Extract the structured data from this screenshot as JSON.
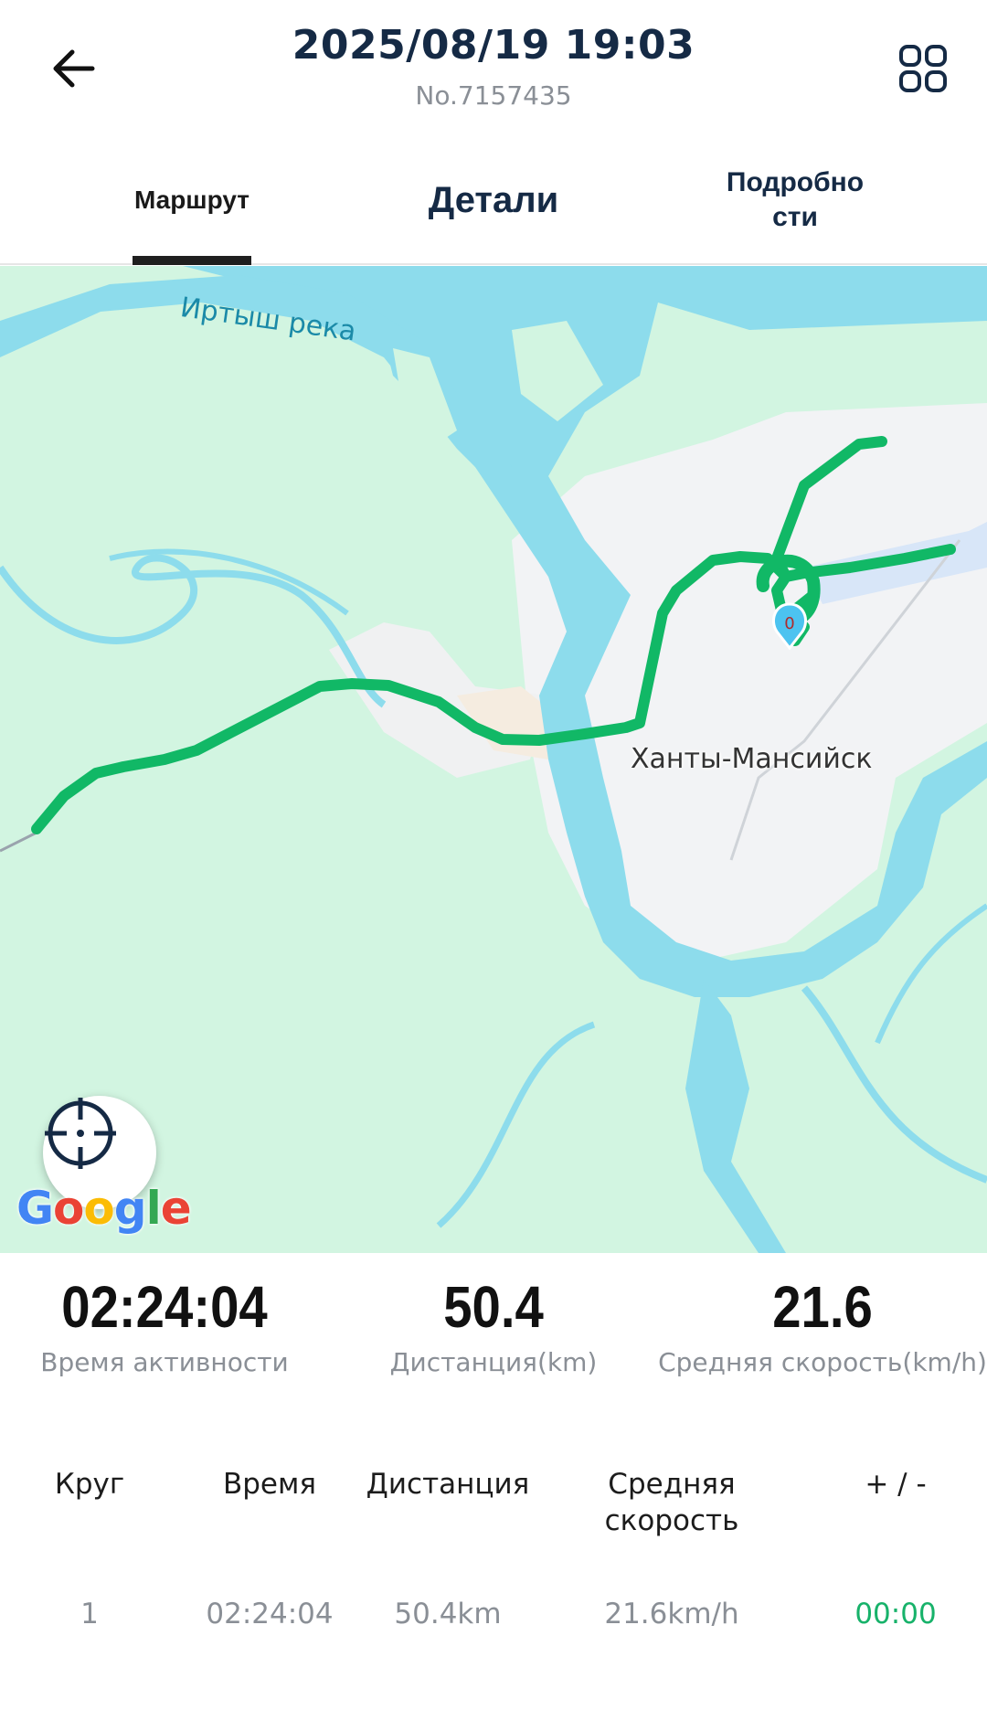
{
  "header": {
    "title": "2025/08/19 19:03",
    "subtitle": "No.7157435",
    "back_icon": "arrow-left-icon",
    "menu_icon": "grid-icon"
  },
  "tabs": [
    {
      "label": "Маршрут",
      "active": true
    },
    {
      "label": "Детали",
      "active": false
    },
    {
      "label": "Подробно\nсти",
      "active": false
    }
  ],
  "map": {
    "river_label": "Иртыш река",
    "city_label": "Ханты-Мансийск",
    "start_marker": "0",
    "attribution": "Google",
    "recenter_icon": "crosshair-icon",
    "colors": {
      "land": "#d2f5e1",
      "water": "#8ddcec",
      "city": "#f2f3f5",
      "route": "#11b866",
      "marker": "#4cc3f0"
    }
  },
  "stats": [
    {
      "value": "02:24:04",
      "label": "Время активности"
    },
    {
      "value": "50.4",
      "label": "Дистанция(km)"
    },
    {
      "value": "21.6",
      "label": "Средняя скорость(km/h)"
    }
  ],
  "laps": {
    "headers": [
      "Круг",
      "Время",
      "Дистанция",
      "Средняя скорость",
      "+ / -"
    ],
    "rows": [
      [
        "1",
        "02:24:04",
        "50.4km",
        "21.6km/h",
        "00:00"
      ]
    ]
  }
}
